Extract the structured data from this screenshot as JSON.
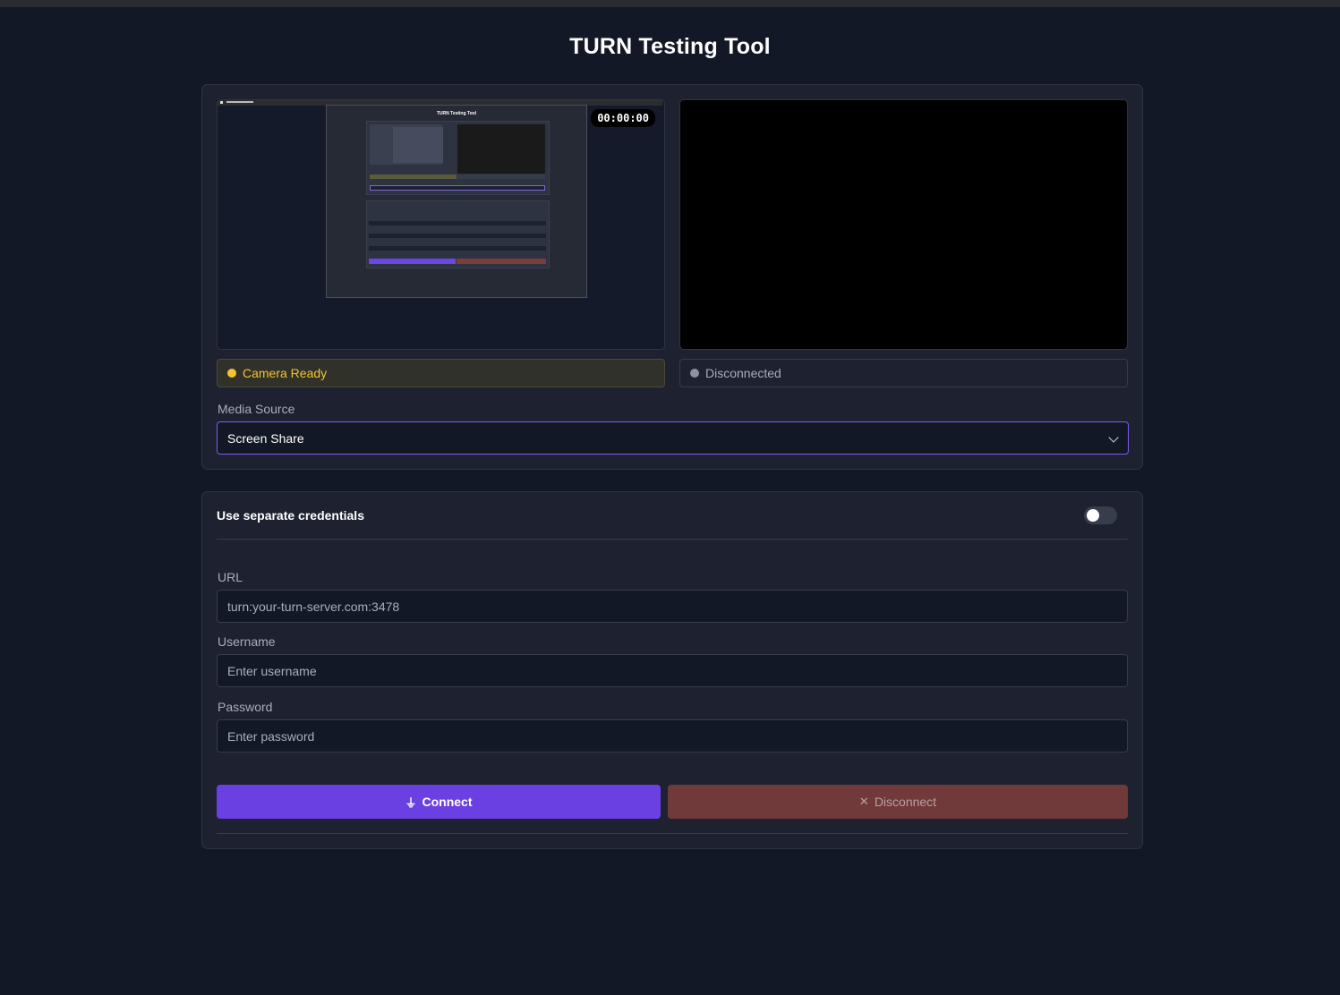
{
  "app": {
    "title": "TURN Testing Tool"
  },
  "media": {
    "timer": "00:00:00",
    "local_status": "Camera Ready",
    "remote_status": "Disconnected",
    "source_label": "Media Source",
    "source_value": "Screen Share",
    "local_status_color": "#f5c330"
  },
  "credentials": {
    "toggle_label": "Use separate credentials",
    "toggle_on": false,
    "url_label": "URL",
    "url_placeholder": "turn:your-turn-server.com:3478",
    "username_label": "Username",
    "username_placeholder": "Enter username",
    "password_label": "Password",
    "password_placeholder": "Enter password"
  },
  "actions": {
    "connect_icon": "plug-icon",
    "connect_label": "Connect",
    "disconnect_icon": "close-icon",
    "disconnect_label": "Disconnect",
    "connect_color": "#6b40e3",
    "disconnect_color": "#703a3a"
  }
}
